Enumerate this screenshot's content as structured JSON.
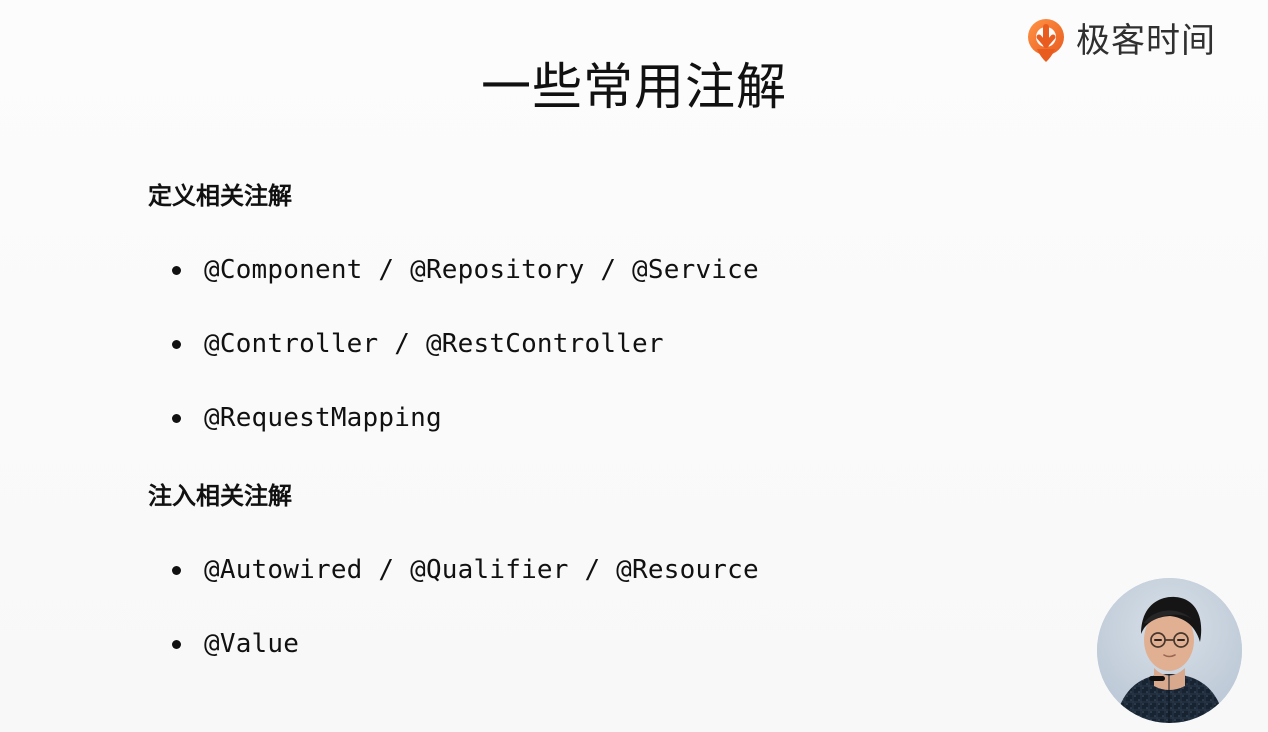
{
  "slide": {
    "title": "一些常用注解",
    "brand": {
      "name": "极客时间",
      "logo_icon": "geektime-logo-icon",
      "accent": "#f27a32"
    },
    "sections": [
      {
        "heading": "定义相关注解",
        "items": [
          "@Component / @Repository / @Service",
          "@Controller / @RestController",
          "@RequestMapping"
        ]
      },
      {
        "heading": "注入相关注解",
        "items": [
          "@Autowired / @Qualifier / @Resource",
          "@Value"
        ]
      }
    ],
    "presenter_avatar_icon": "presenter-video-avatar"
  }
}
